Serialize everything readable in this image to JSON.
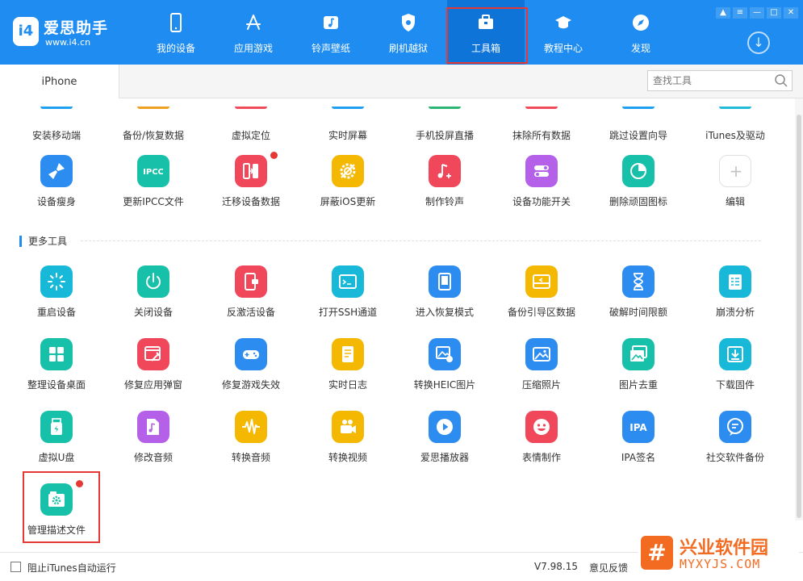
{
  "app": {
    "logo_badge": "i4",
    "name": "爱思助手",
    "url": "www.i4.cn"
  },
  "nav": {
    "items": [
      {
        "label": "我的设备",
        "icon": "phone-icon"
      },
      {
        "label": "应用游戏",
        "icon": "app-store-icon"
      },
      {
        "label": "铃声壁纸",
        "icon": "music-note-icon"
      },
      {
        "label": "刷机越狱",
        "icon": "flash-shield-icon"
      },
      {
        "label": "工具箱",
        "icon": "toolbox-icon",
        "active": true
      },
      {
        "label": "教程中心",
        "icon": "graduation-cap-icon"
      },
      {
        "label": "发现",
        "icon": "compass-icon"
      }
    ]
  },
  "window_controls": [
    "shirt-icon",
    "list-icon",
    "minimize-icon",
    "maximize-icon",
    "close-icon"
  ],
  "tabs": {
    "device": "iPhone"
  },
  "search": {
    "placeholder": "查找工具"
  },
  "tools_partial": [
    {
      "label": "安装移动端",
      "color": "#1fa0f0"
    },
    {
      "label": "备份/恢复数据",
      "color": "#f0a020"
    },
    {
      "label": "虚拟定位",
      "color": "#f04b5a"
    },
    {
      "label": "实时屏幕",
      "color": "#1fa0f0"
    },
    {
      "label": "手机投屏直播",
      "color": "#2bb673"
    },
    {
      "label": "抹除所有数据",
      "color": "#f04b5a"
    },
    {
      "label": "跳过设置向导",
      "color": "#1fa0f0"
    },
    {
      "label": "iTunes及驱动",
      "color": "#1fbbd8"
    }
  ],
  "tools_row1": [
    {
      "label": "设备瘦身",
      "color": "#2d8cf0",
      "icon": "broom-icon"
    },
    {
      "label": "更新IPCC文件",
      "color": "#17c0a8",
      "icon": "ipcc-icon",
      "glyph": "IPCC"
    },
    {
      "label": "迁移设备数据",
      "color": "#f0475a",
      "icon": "transfer-icon",
      "badge": true
    },
    {
      "label": "屏蔽iOS更新",
      "color": "#f5b800",
      "icon": "gear-block-icon"
    },
    {
      "label": "制作铃声",
      "color": "#f0475a",
      "icon": "music-plus-icon"
    },
    {
      "label": "设备功能开关",
      "color": "#b460e8",
      "icon": "toggle-icon"
    },
    {
      "label": "删除顽固图标",
      "color": "#17c0a8",
      "icon": "pie-icon"
    },
    {
      "label": "编辑",
      "color": "#ffffff",
      "icon": "plus-icon",
      "glyph": "+"
    }
  ],
  "section": {
    "title": "更多工具"
  },
  "tools_more": [
    {
      "label": "重启设备",
      "color": "#17b8d8",
      "icon": "restart-icon"
    },
    {
      "label": "关闭设备",
      "color": "#17c0a8",
      "icon": "power-icon"
    },
    {
      "label": "反激活设备",
      "color": "#f0475a",
      "icon": "deactivate-icon"
    },
    {
      "label": "打开SSH通道",
      "color": "#17b8d8",
      "icon": "terminal-icon"
    },
    {
      "label": "进入恢复模式",
      "color": "#2d8cf0",
      "icon": "tablet-icon"
    },
    {
      "label": "备份引导区数据",
      "color": "#f5b800",
      "icon": "drive-icon"
    },
    {
      "label": "破解时间限额",
      "color": "#2d8cf0",
      "icon": "hourglass-icon"
    },
    {
      "label": "崩溃分析",
      "color": "#17b8d8",
      "icon": "report-icon"
    },
    {
      "label": "整理设备桌面",
      "color": "#17c0a8",
      "icon": "grid-icon"
    },
    {
      "label": "修复应用弹窗",
      "color": "#f0475a",
      "icon": "wrench-window-icon"
    },
    {
      "label": "修复游戏失效",
      "color": "#2d8cf0",
      "icon": "gamepad-icon"
    },
    {
      "label": "实时日志",
      "color": "#f5b800",
      "icon": "log-icon"
    },
    {
      "label": "转换HEIC图片",
      "color": "#2d8cf0",
      "icon": "image-convert-icon"
    },
    {
      "label": "压缩照片",
      "color": "#2d8cf0",
      "icon": "image-icon"
    },
    {
      "label": "图片去重",
      "color": "#17c0a8",
      "icon": "images-icon"
    },
    {
      "label": "下载固件",
      "color": "#17b8d8",
      "icon": "download-box-icon"
    },
    {
      "label": "虚拟U盘",
      "color": "#17c0a8",
      "icon": "usb-icon"
    },
    {
      "label": "修改音频",
      "color": "#b460e8",
      "icon": "audio-file-icon"
    },
    {
      "label": "转换音频",
      "color": "#f5b800",
      "icon": "waveform-icon"
    },
    {
      "label": "转换视频",
      "color": "#f5b800",
      "icon": "video-camera-icon"
    },
    {
      "label": "爱思播放器",
      "color": "#2d8cf0",
      "icon": "play-icon"
    },
    {
      "label": "表情制作",
      "color": "#f0475a",
      "icon": "smiley-icon"
    },
    {
      "label": "IPA签名",
      "color": "#2d8cf0",
      "icon": "ipa-icon",
      "glyph": "IPA"
    },
    {
      "label": "社交软件备份",
      "color": "#2d8cf0",
      "icon": "chat-icon"
    },
    {
      "label": "管理描述文件",
      "color": "#17c0a8",
      "icon": "profile-gear-icon",
      "badge": true
    }
  ],
  "footer": {
    "checkbox_label": "阻止iTunes自动运行",
    "version": "V7.98.15",
    "feedback": "意见反馈"
  },
  "watermark": {
    "logo_glyph": "#",
    "name": "兴业软件园",
    "url": "MYXYJS.COM"
  }
}
